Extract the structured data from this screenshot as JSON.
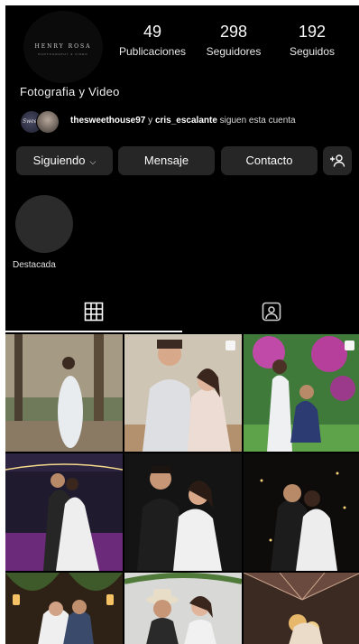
{
  "profile": {
    "logo_text": "HENRY ROSA",
    "logo_subtext": "PHOTOGRAPHY & VIDEO",
    "stats": [
      {
        "value": "49",
        "label": "Publicaciones"
      },
      {
        "value": "298",
        "label": "Seguidores"
      },
      {
        "value": "192",
        "label": "Seguidos"
      }
    ],
    "bio": "Fotografia y Video",
    "followed_by": {
      "avatar1_text": "Sweet",
      "user1": "thesweethouse97",
      "connector": " y ",
      "user2": "cris_escalante",
      "suffix": " siguen esta cuenta"
    }
  },
  "actions": {
    "following_label": "Siguiendo",
    "message_label": "Mensaje",
    "contact_label": "Contacto"
  },
  "highlights": [
    {
      "label": "Destacada"
    }
  ],
  "tabs": [
    "grid",
    "tagged"
  ],
  "grid": {
    "posts": [
      {
        "scene": "maternity-forest",
        "multi": true
      },
      {
        "scene": "couple-bride-groom",
        "multi": true
      },
      {
        "scene": "proposal-garden",
        "multi": true
      },
      {
        "scene": "first-dance-purple",
        "multi": false
      },
      {
        "scene": "couple-portrait-night",
        "multi": false
      },
      {
        "scene": "kiss-sparkle",
        "multi": false
      },
      {
        "scene": "couple-lanterns",
        "multi": false
      },
      {
        "scene": "cowboy-hat-couple",
        "multi": false
      },
      {
        "scene": "tent-lights",
        "multi": false
      }
    ]
  }
}
